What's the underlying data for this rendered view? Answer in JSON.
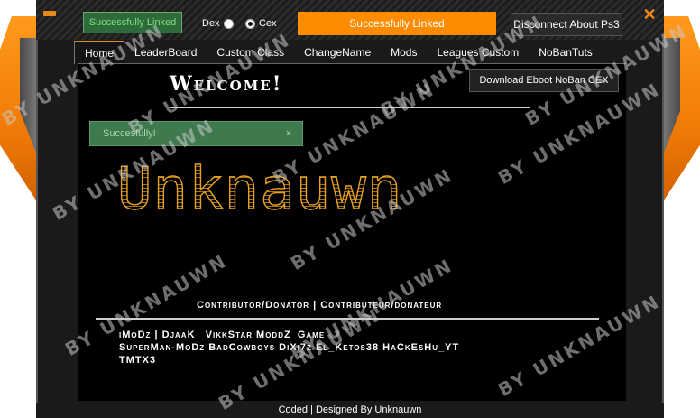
{
  "window": {
    "minimize_icon": "minimize-icon",
    "close_icon": "close-icon",
    "close_glyph": "✕"
  },
  "top": {
    "status_label": "Successfully Linked",
    "radio_dex_label": "Dex",
    "radio_cex_label": "Cex",
    "radio_selected": "Cex",
    "linked_banner": "Successfully Linked",
    "disconnect_label": "Disconnect About Ps3"
  },
  "tabs": [
    {
      "label": "Home",
      "active": true
    },
    {
      "label": "LeaderBoard",
      "active": false
    },
    {
      "label": "Custom Class",
      "active": false
    },
    {
      "label": "ChangeName",
      "active": false
    },
    {
      "label": "Mods",
      "active": false
    },
    {
      "label": "Leagues Custom",
      "active": false
    },
    {
      "label": "NoBanTuts",
      "active": false
    }
  ],
  "home": {
    "welcome": "Welcome!",
    "download_label": "Download Eboot NoBan CEX",
    "toast_text": "Succesfully!",
    "toast_close": "×",
    "logo_text": "Unknauwn",
    "contrib_title": "Contributor/Donator  |  Contributeur/donateur",
    "names_line1": "iMoDz | DjaaK_  VikkStar  ModdZ_Game",
    "names_line2": "SuperMan-MoDz  BadCowboys  DiXi7z  El_Ketos38  HaCkEsHu_YT",
    "names_line3": "TMTX3"
  },
  "footer": {
    "text": "Coded | Designed By Unknauwn"
  },
  "watermark": {
    "text": "BY UNKNAUWN"
  },
  "colors": {
    "accent": "#ff8c00",
    "panel": "#1a1a1a",
    "status_green": "#2f6a3a",
    "logo_gold": "#e8a020"
  }
}
